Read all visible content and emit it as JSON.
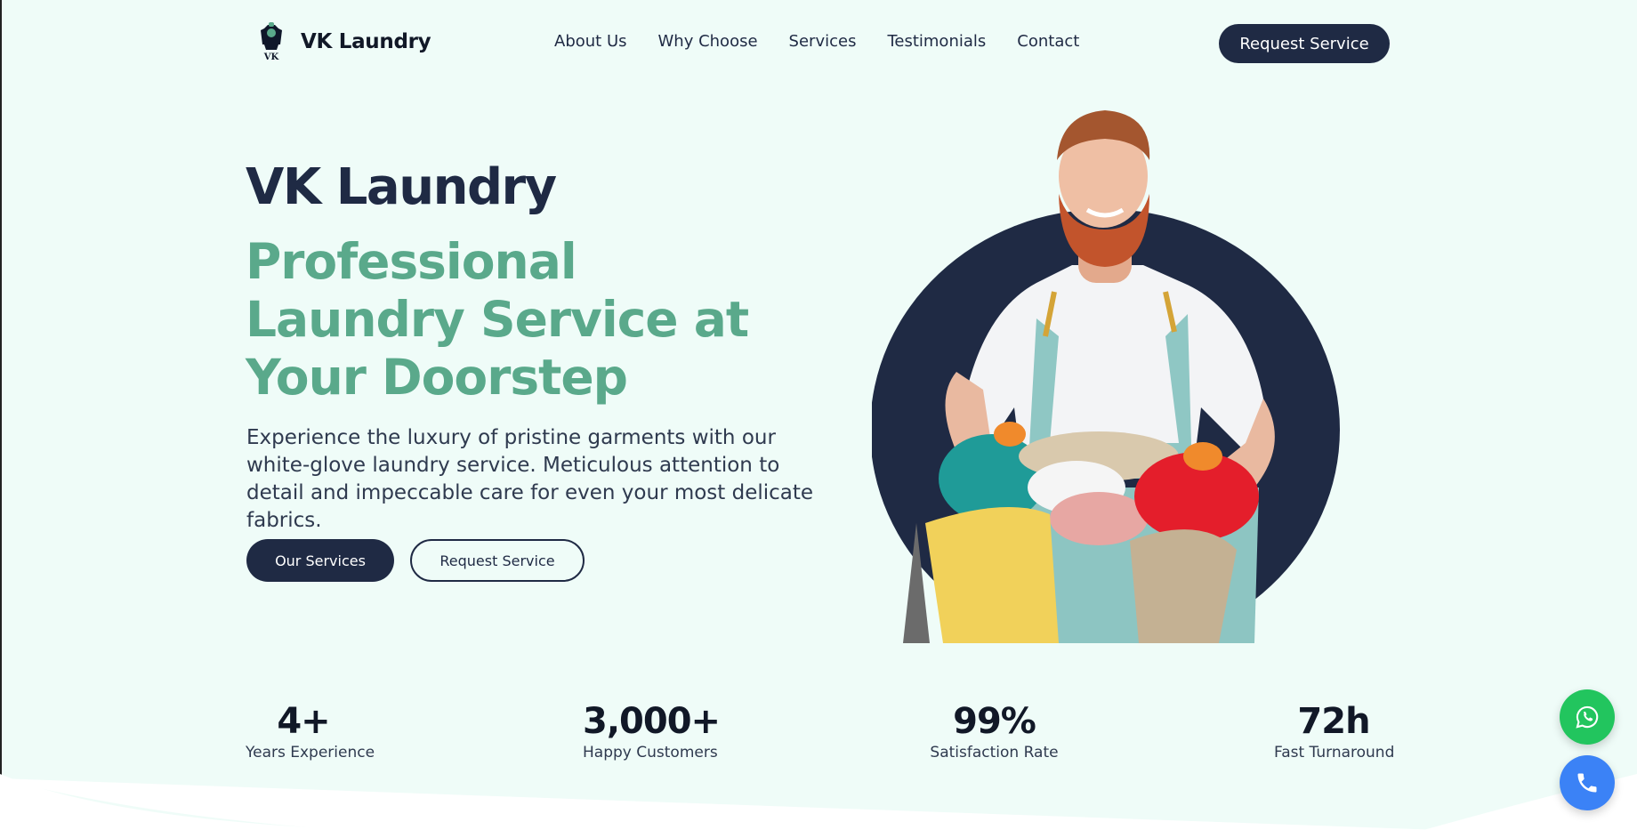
{
  "header": {
    "logo_text": "VK",
    "brand": "VK Laundry",
    "nav": [
      {
        "label": "About Us"
      },
      {
        "label": "Why Choose"
      },
      {
        "label": "Services"
      },
      {
        "label": "Testimonials"
      },
      {
        "label": "Contact"
      }
    ],
    "cta_label": "Request Service"
  },
  "hero": {
    "kicker": "VK Laundry",
    "title": "Professional Laundry Service at Your Doorstep",
    "description": "Experience the luxury of pristine garments with our white-glove laundry service. Meticulous attention to detail and impeccable care for even your most delicate fabrics.",
    "primary_button": "Our Services",
    "secondary_button": "Request Service"
  },
  "stats": [
    {
      "value": "4+",
      "label": "Years Experience"
    },
    {
      "value": "3,000+",
      "label": "Happy Customers"
    },
    {
      "value": "99%",
      "label": "Satisfaction Rate"
    },
    {
      "value": "72h",
      "label": "Fast Turnaround"
    }
  ],
  "floating": {
    "whatsapp_icon": "whatsapp-icon",
    "phone_icon": "phone-icon"
  },
  "colors": {
    "background": "#effcf8",
    "navy": "#1f2a44",
    "accent_green": "#5aa98b",
    "whatsapp": "#22c55e",
    "call": "#3b82f6"
  }
}
